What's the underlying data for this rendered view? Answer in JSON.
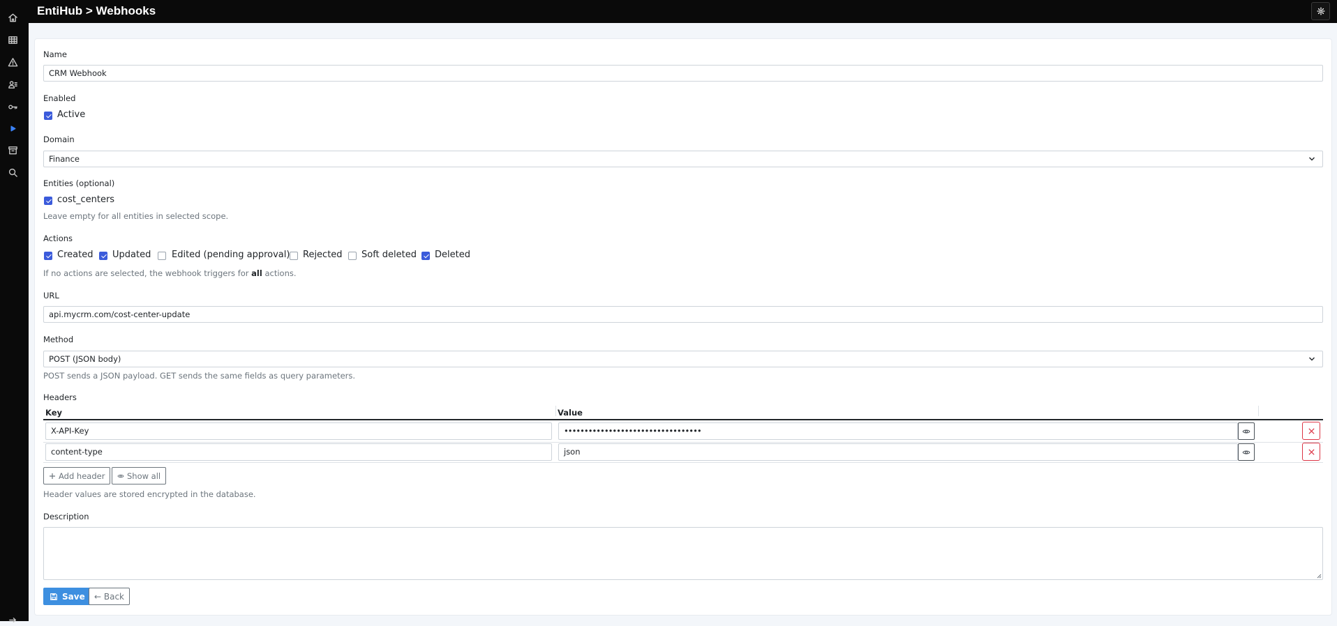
{
  "app": {
    "breadcrumb": "EntiHub > Webhooks"
  },
  "sidebar": {
    "items": [
      {
        "icon": "home-icon"
      },
      {
        "icon": "table-icon"
      },
      {
        "icon": "warning-icon"
      },
      {
        "icon": "users-icon"
      },
      {
        "icon": "key-icon"
      },
      {
        "icon": "play-icon",
        "active": true
      },
      {
        "icon": "archive-icon"
      },
      {
        "icon": "search-icon"
      }
    ],
    "bottom_icon": "logout-icon"
  },
  "form": {
    "name": {
      "label": "Name",
      "value": "CRM Webhook"
    },
    "enabled": {
      "label": "Enabled",
      "checkbox_label": "Active",
      "checked": true
    },
    "domain": {
      "label": "Domain",
      "value": "Finance"
    },
    "entities": {
      "label": "Entities (optional)",
      "options": [
        {
          "label": "cost_centers",
          "checked": true
        }
      ],
      "help": "Leave empty for all entities in selected scope."
    },
    "actions": {
      "label": "Actions",
      "options": [
        {
          "label": "Created",
          "checked": true
        },
        {
          "label": "Updated",
          "checked": true
        },
        {
          "label": "Edited (pending approval)",
          "checked": false
        },
        {
          "label": "Rejected",
          "checked": false
        },
        {
          "label": "Soft deleted",
          "checked": false
        },
        {
          "label": "Deleted",
          "checked": true
        }
      ],
      "help_prefix": "If no actions are selected, the webhook triggers for ",
      "help_bold": "all",
      "help_suffix": " actions."
    },
    "url": {
      "label": "URL",
      "value": "api.mycrm.com/cost-center-update"
    },
    "method": {
      "label": "Method",
      "value": "POST (JSON body)",
      "help": "POST sends a JSON payload. GET sends the same fields as query parameters."
    },
    "headers": {
      "label": "Headers",
      "columns": {
        "key": "Key",
        "value": "Value"
      },
      "rows": [
        {
          "key": "X-API-Key",
          "value": "••••••••••••••••••••••••••••••••••"
        },
        {
          "key": "content-type",
          "value": "json"
        }
      ],
      "add_label": "Add header",
      "show_all_label": "Show all",
      "help": "Header values are stored encrypted in the database."
    },
    "description": {
      "label": "Description",
      "value": ""
    },
    "save_label": "Save",
    "back_label": "← Back"
  },
  "colors": {
    "accent": "#3b5bdb",
    "primary_button": "#3d8fe0",
    "danger": "#dc3545",
    "topbar": "#0a0a0a"
  }
}
